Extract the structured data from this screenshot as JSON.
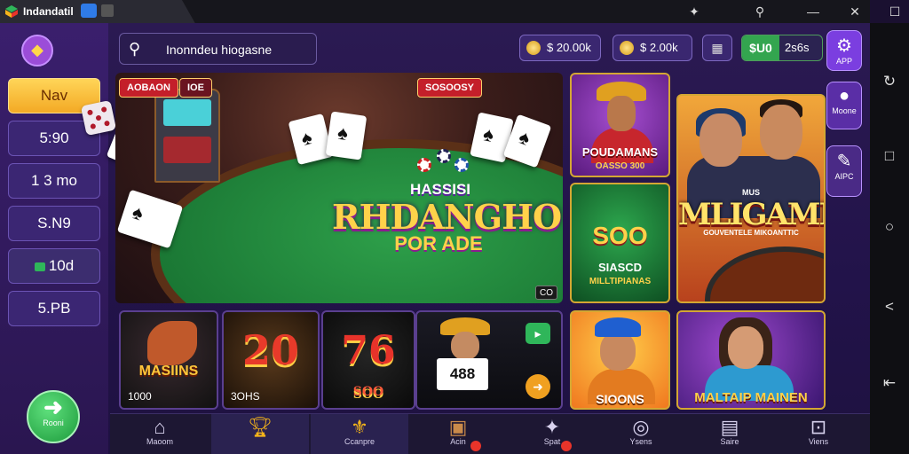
{
  "window": {
    "app_name": "Indandatil",
    "controls": {
      "minimize": "—",
      "maximize": "☐",
      "close": "✕"
    },
    "extra_icons": [
      "puzzle-icon",
      "location-icon"
    ]
  },
  "android_nav": [
    "rotate-icon",
    "square-icon",
    "circle-icon",
    "back-icon",
    "exit-icon"
  ],
  "left_menu": {
    "back_icon": "diamond-left-icon",
    "items": [
      {
        "label": "Nav",
        "style": "primary"
      },
      {
        "label": "5:90"
      },
      {
        "label": "1 3 mo"
      },
      {
        "label": "S.N9"
      },
      {
        "label": "10d"
      },
      {
        "label": "5.PB"
      }
    ],
    "go_button": {
      "label": "Rooni"
    }
  },
  "topbar": {
    "search": {
      "text": "Inonndeu hiogasne"
    },
    "balances": [
      {
        "value": "$ 20.00k"
      },
      {
        "value": "$ 2.00k"
      }
    ],
    "wallet": {
      "green": "$U0",
      "value": "2s6s"
    },
    "right_icons": [
      {
        "label": "APP",
        "icon": "gear-icon"
      },
      {
        "label": "Moone",
        "icon": "cookie-icon"
      },
      {
        "label": "AIPC",
        "icon": "feather-icon"
      }
    ]
  },
  "hero": {
    "tag_left": "AOBAON",
    "tag_left2": "IOE",
    "tag_mid": "SOSOOSY",
    "title_small": "HASSISI",
    "title_main": "RHDANGHO",
    "title_sub": "POR ADE",
    "badge": "CO"
  },
  "games": {
    "pondam": {
      "title": "POUDAMANS",
      "sub": "OASSO 300"
    },
    "mlig": {
      "top": "MUS",
      "title": "MLIGAMES",
      "sub": "GOUVENTELE MIKOANTTIC"
    },
    "siasco": {
      "big": "SOO",
      "title": "SIASCD",
      "sub": "MILLTIPIANAS"
    },
    "masiins": {
      "title": "MASIINS",
      "value": "1000"
    },
    "twenty": {
      "title": "20",
      "value": "3OHS"
    },
    "seventy": {
      "title": "76",
      "sub": "SOO"
    },
    "four88": {
      "sign": "488"
    },
    "sioons": {
      "title": "SIOONS"
    },
    "malt": {
      "title": "MALTAIP MAINEN"
    }
  },
  "bottom_nav": [
    {
      "label": "Maoom",
      "icon": "home-icon"
    },
    {
      "label": "",
      "icon": "trophy-icon"
    },
    {
      "label": "Ccanpre",
      "icon": "fleur-icon"
    },
    {
      "label": "Acin",
      "icon": "chest-icon"
    },
    {
      "label": "Spat",
      "icon": "gem-icon"
    },
    {
      "label": "Ysens",
      "icon": "circle-icon"
    },
    {
      "label": "Saire",
      "icon": "card-icon"
    },
    {
      "label": "Viens",
      "icon": "robot-icon"
    }
  ]
}
